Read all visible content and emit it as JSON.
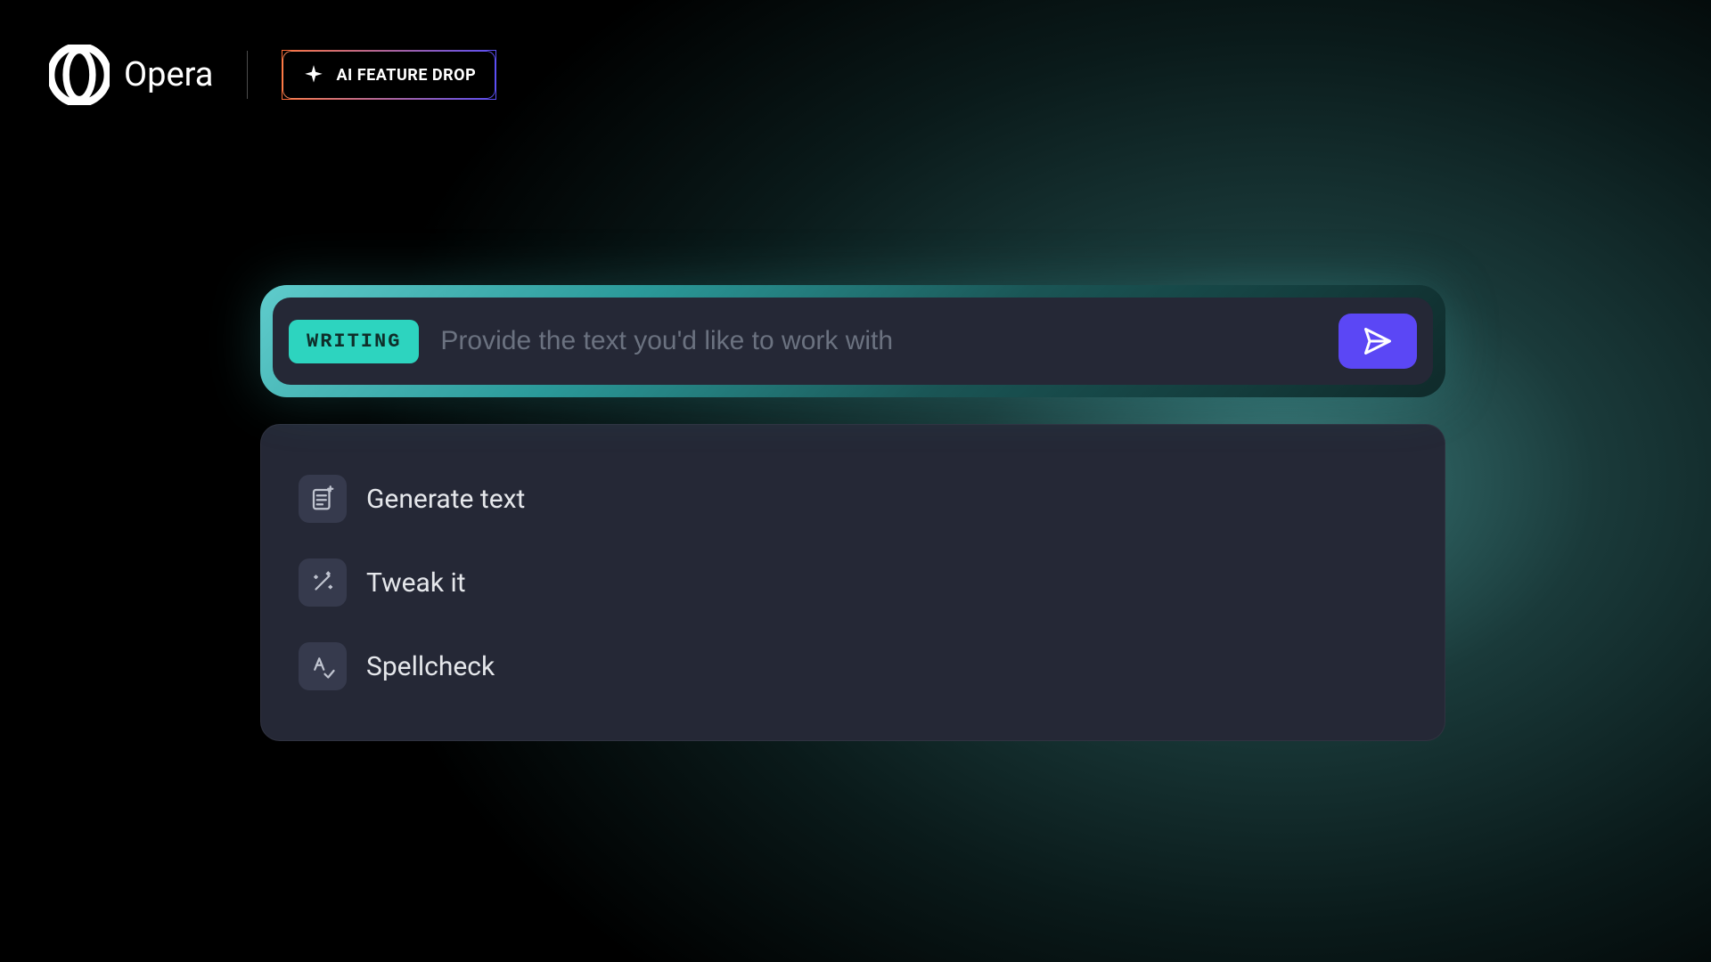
{
  "header": {
    "brand_name": "Opera",
    "feature_badge_text": "AI FEATURE DROP"
  },
  "input": {
    "mode_label": "WRITING",
    "placeholder": "Provide the text you'd like to work with"
  },
  "options": [
    {
      "label": "Generate text",
      "icon": "document-plus"
    },
    {
      "label": "Tweak it",
      "icon": "magic-wand"
    },
    {
      "label": "Spellcheck",
      "icon": "spellcheck"
    }
  ]
}
